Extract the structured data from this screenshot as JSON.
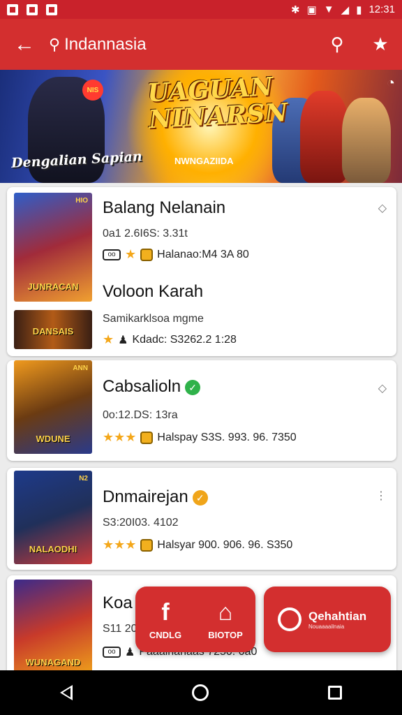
{
  "status_bar": {
    "time": "12:31"
  },
  "app_bar": {
    "title": "Indannasia"
  },
  "banner": {
    "title": "UAGUAN NINARSN",
    "caption": "Dengalian Sapian",
    "subtitle": "NWNGAZIIDA",
    "badge": "NIS"
  },
  "cards": [
    {
      "name": "Balang Nelanain",
      "meta": "0a1 2.6I6S: 3.31t",
      "line2": "Halanao:M4  3A  80",
      "thumb_label": "JUNRACAN",
      "thumb_tag": "HIO",
      "sub_name": "Voloon Karah",
      "sub_meta": "Samikarklsoa mgme",
      "sub_line": "Kdadc: S3262.2  1:28",
      "sub_thumb_label": "DANSAIS"
    },
    {
      "name": "Cabsalioln",
      "meta": "0o:12.DS: 13ra",
      "line2": "Halspay S3S. 993. 96. 7350",
      "thumb_label": "WDUNE",
      "thumb_tag": "ANN",
      "verified_color": "#2fb24a"
    },
    {
      "name": "Dnmairejan",
      "meta": "S3:20I03. 4102",
      "line2": "Halsyar 900. 906. 96. S350",
      "thumb_label": "NALAODHI",
      "thumb_tag": "N2",
      "verified_color": "#f0a51a"
    },
    {
      "name": "Koa",
      "meta": "S11 20",
      "line2": "Paaalnanaas 7250. 0a0",
      "thumb_label": "WUNAGAND"
    }
  ],
  "fab": {
    "left_label": "CNDLG",
    "right_label": "BIOTOP",
    "action_text": "Qehahtian",
    "action_sub": "Nouaaaailnaia"
  }
}
